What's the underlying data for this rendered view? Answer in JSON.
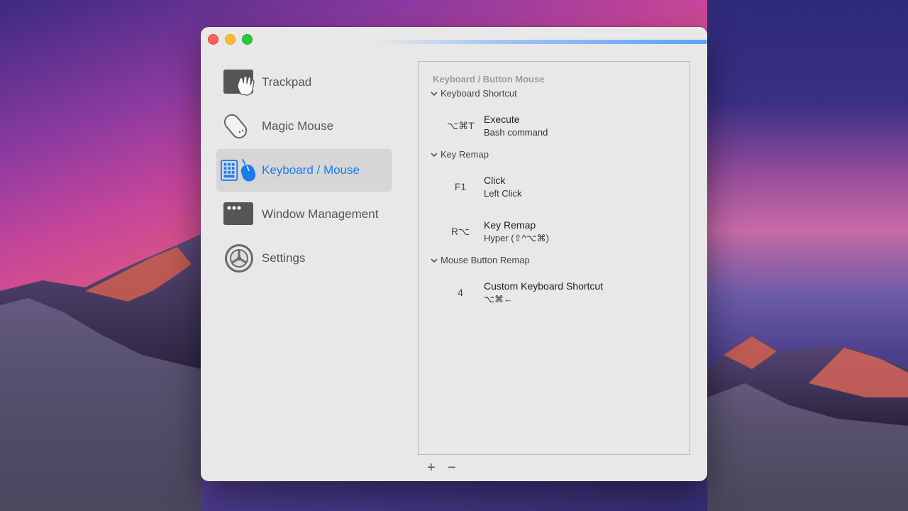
{
  "colors": {
    "accent": "#1a7cf0",
    "close": "#fe5f57",
    "minimize": "#febc2e",
    "maximize": "#28c840"
  },
  "window": {
    "traffic_lights": [
      "close",
      "minimize",
      "maximize"
    ]
  },
  "sidebar": {
    "items": [
      {
        "label": "Trackpad",
        "icon": "trackpad-icon",
        "selected": false
      },
      {
        "label": "Magic Mouse",
        "icon": "magic-mouse-icon",
        "selected": false
      },
      {
        "label": "Keyboard / Mouse",
        "icon": "keyboard-mouse-icon",
        "selected": true
      },
      {
        "label": "Window Management",
        "icon": "window-icon",
        "selected": false
      },
      {
        "label": "Settings",
        "icon": "gear-icon",
        "selected": false
      }
    ]
  },
  "panel": {
    "header": "Keyboard / Button Mouse",
    "groups": [
      {
        "label": "Keyboard Shortcut",
        "entries": [
          {
            "key": "⌥⌘T",
            "title": "Execute",
            "subtitle": "Bash command"
          }
        ]
      },
      {
        "label": "Key Remap",
        "entries": [
          {
            "key": "F1",
            "title": "Click",
            "subtitle": "Left Click"
          },
          {
            "key": "R⌥",
            "title": "Key Remap",
            "subtitle": "Hyper (⇧^⌥⌘)"
          }
        ]
      },
      {
        "label": "Mouse Button Remap",
        "entries": [
          {
            "key": "4",
            "title": "Custom Keyboard Shortcut",
            "subtitle": "⌥⌘←"
          }
        ]
      }
    ]
  },
  "footer": {
    "add_label": "+",
    "remove_label": "−"
  }
}
